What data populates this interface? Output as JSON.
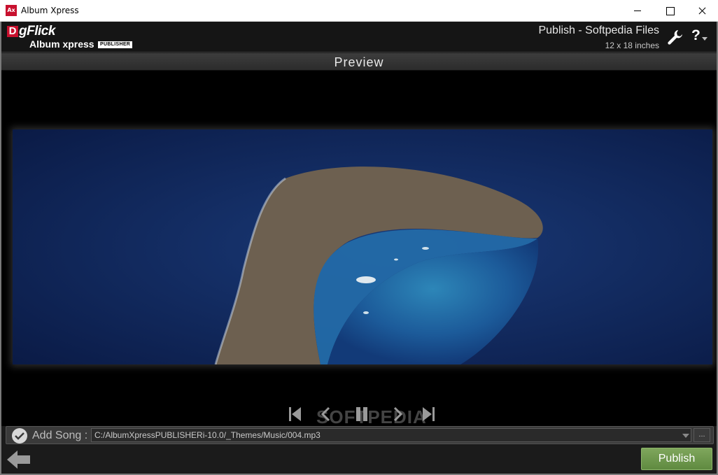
{
  "window": {
    "icon_label": "Ax",
    "title": "Album Xpress"
  },
  "header": {
    "logo_brand": "gFlick",
    "logo_letter": "D",
    "logo_product": "Album xpress",
    "logo_badge": "PUBLISHER",
    "project_title": "Publish - Softpedia Files",
    "project_size": "12 x 18 inches",
    "icons": [
      "wrench-icon",
      "help-icon"
    ]
  },
  "preview": {
    "title": "Preview"
  },
  "watermark": "SOFTPEDIA",
  "song": {
    "label": "Add Song :",
    "path": "C:/AlbumXpressPUBLISHERi-10.0/_Themes/Music/004.mp3",
    "browse_label": "..."
  },
  "footer": {
    "publish_label": "Publish"
  },
  "colors": {
    "publish": "#6f9a4e",
    "logo_red": "#c8102e",
    "stage": "#000000"
  }
}
